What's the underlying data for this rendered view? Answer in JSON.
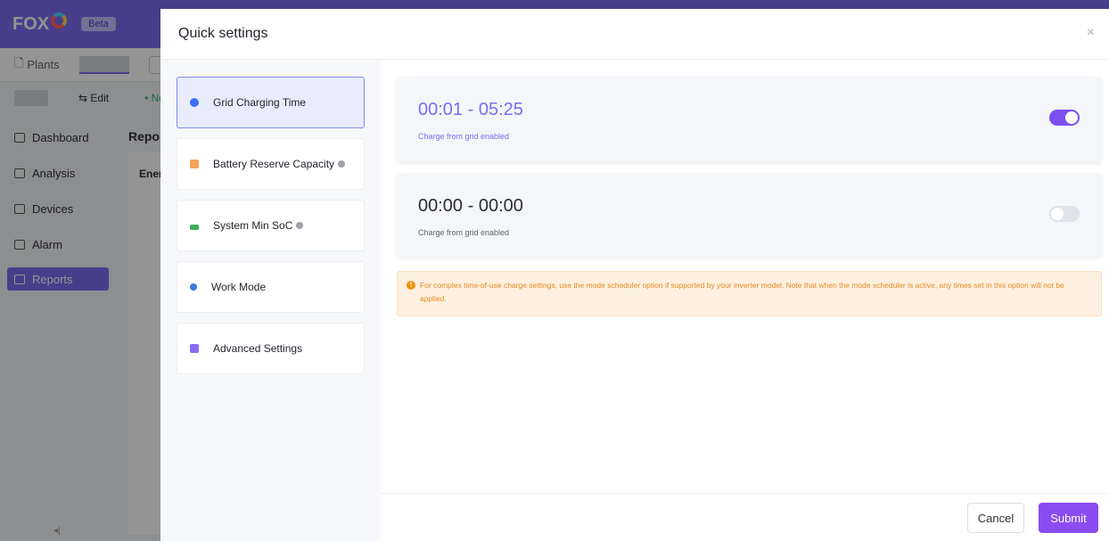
{
  "app": {
    "logo": "FOX",
    "beta_label": "Beta",
    "tab_plants": "Plants",
    "edit_label": "Edit",
    "status_label": "Norr",
    "sidebar": [
      {
        "label": "Dashboard",
        "icon": "dashboard-icon"
      },
      {
        "label": "Analysis",
        "icon": "analysis-icon"
      },
      {
        "label": "Devices",
        "icon": "devices-icon"
      },
      {
        "label": "Alarm",
        "icon": "alarm-icon"
      },
      {
        "label": "Reports",
        "icon": "reports-icon",
        "active": true
      }
    ],
    "report_title": "Report",
    "energy_label": "Ener"
  },
  "drawer": {
    "title": "Quick settings",
    "close_icon": "×",
    "menu": [
      {
        "label": "Grid Charging Time",
        "icon": "grid-charging-icon",
        "color": "#3b6ff5",
        "active": true
      },
      {
        "label": "Battery Reserve Capacity",
        "icon": "battery-reserve-icon",
        "color": "#f5a25b",
        "help": true
      },
      {
        "label": "System Min SoC",
        "icon": "min-soc-icon",
        "color": "#3fae5c",
        "help": true
      },
      {
        "label": "Work Mode",
        "icon": "work-mode-icon",
        "color": "#3b7bd9"
      },
      {
        "label": "Advanced Settings",
        "icon": "advanced-settings-icon",
        "color": "#8a6cf0"
      }
    ],
    "slots": [
      {
        "time": "00:01 - 05:25",
        "sub": "Charge from grid enabled",
        "enabled": true
      },
      {
        "time": "00:00 - 00:00",
        "sub": "Charge from grid enabled",
        "enabled": false
      }
    ],
    "alert": "For complex time-of-use charge settings, use the mode scheduler option if supported by your inverter model. Note that when the mode scheduler is active, any times set in this option will not be applied.",
    "cancel_label": "Cancel",
    "submit_label": "Submit"
  },
  "colors": {
    "accent": "#7b6bf0",
    "submit": "#8a4cf0",
    "warning": "#e58a1f"
  }
}
